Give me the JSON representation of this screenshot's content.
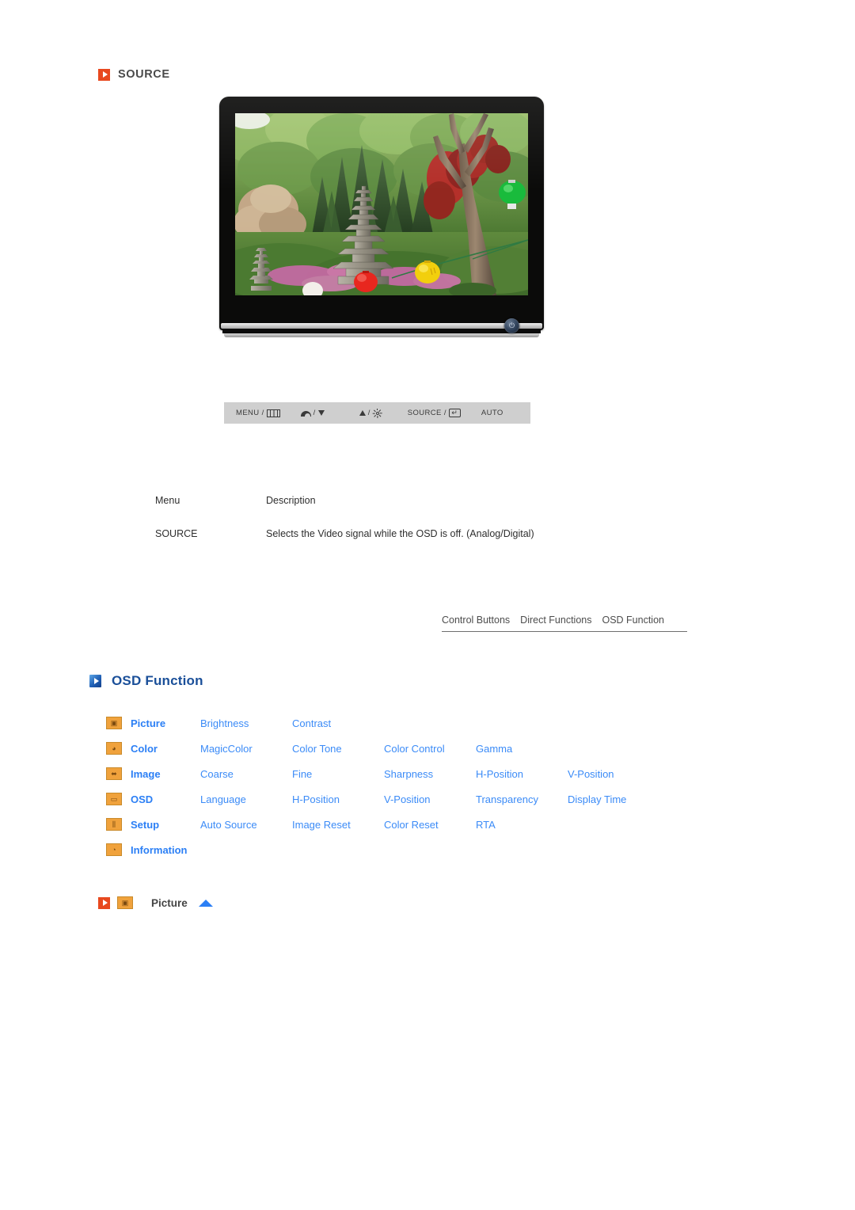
{
  "source_section": {
    "heading": "SOURCE",
    "heading_icon": "play-square-orange-icon",
    "accent_color": "#e8491f"
  },
  "monitor": {
    "alt": "LCD monitor displaying a garden photo with stone pagodas and paper lanterns",
    "power_button_icon": "power-icon"
  },
  "control_bar": {
    "buttons": [
      {
        "label": "MENU /",
        "icon": "menu-bars-icon"
      },
      {
        "label": "/",
        "icon_left": "volume-icon",
        "icon_right": "triangle-down-icon"
      },
      {
        "label": "/",
        "icon_left": "triangle-up-icon",
        "icon_right": "brightness-sun-icon"
      },
      {
        "label": "SOURCE /",
        "icon": "enter-key-icon"
      },
      {
        "label": "AUTO",
        "icon": ""
      }
    ]
  },
  "menu_table": {
    "header": {
      "menu": "Menu",
      "description": "Description"
    },
    "rows": [
      {
        "menu": "SOURCE",
        "description": "Selects the Video signal while the OSD is off. (Analog/Digital)"
      }
    ]
  },
  "tabs": [
    {
      "label": "Control Buttons"
    },
    {
      "label": "Direct Functions"
    },
    {
      "label": "OSD Function"
    }
  ],
  "osd_section": {
    "heading": "OSD Function",
    "heading_icon": "play-square-blue-icon",
    "accent_color": "#1a4f99"
  },
  "osd_matrix": {
    "link_color": "#3b8bf7",
    "category_color": "#2b7ff5",
    "rows": [
      {
        "icon": "picture-icon",
        "glyph": "▣",
        "category": "Picture",
        "items": [
          "Brightness",
          "Contrast"
        ]
      },
      {
        "icon": "color-palette-icon",
        "glyph": "◕",
        "category": "Color",
        "items": [
          "MagicColor",
          "Color Tone",
          "Color Control",
          "Gamma"
        ]
      },
      {
        "icon": "image-icon",
        "glyph": "⬌",
        "category": "Image",
        "items": [
          "Coarse",
          "Fine",
          "Sharpness",
          "H-Position",
          "V-Position"
        ]
      },
      {
        "icon": "osd-icon",
        "glyph": "▭",
        "category": "OSD",
        "items": [
          "Language",
          "H-Position",
          "V-Position",
          "Transparency",
          "Display Time"
        ]
      },
      {
        "icon": "setup-sliders-icon",
        "glyph": "⫼",
        "category": "Setup",
        "items": [
          "Auto Source",
          "Image Reset",
          "Color Reset",
          "RTA"
        ]
      },
      {
        "icon": "information-icon",
        "glyph": "◔",
        "category": "Information",
        "items": []
      }
    ]
  },
  "picture_footer": {
    "bullet_icon": "play-square-orange-icon",
    "item_icon": "picture-icon",
    "glyph": "▣",
    "label": "Picture",
    "back_to_top_icon": "triangle-up-blue-icon"
  }
}
